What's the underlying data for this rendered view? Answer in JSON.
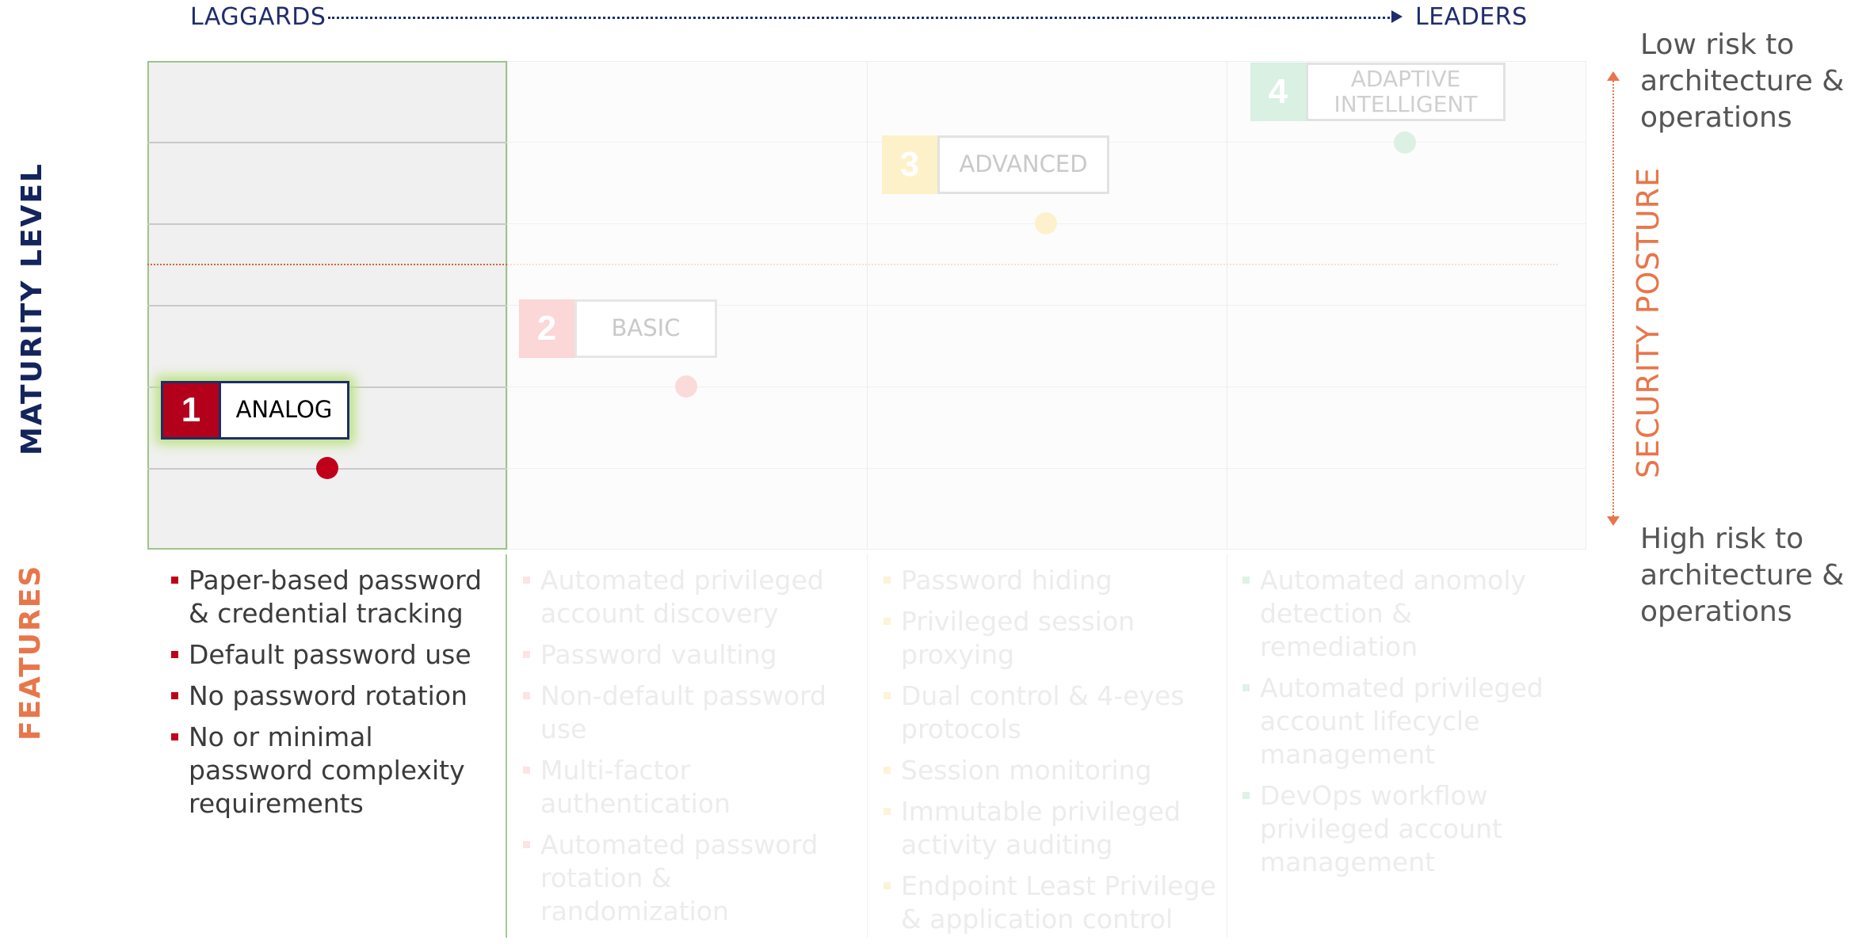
{
  "header": {
    "left_label": "LAGGARDS",
    "right_label": "LEADERS"
  },
  "axis": {
    "maturity_title": "MATURITY  LEVEL",
    "features_title": "FEATURES"
  },
  "security": {
    "title": "SECURITY POSTURE",
    "low_risk": "Low risk to architecture & operations",
    "high_risk": "High risk to architecture & operations",
    "accent": "#e8764a"
  },
  "levels": [
    {
      "number": "1",
      "label": "ANALOG",
      "color": "#b3001b",
      "highlighted": true
    },
    {
      "number": "2",
      "label": "BASIC",
      "color": "#fbd7d7",
      "highlighted": false
    },
    {
      "number": "3",
      "label": "ADVANCED",
      "color": "#fdf1c9",
      "highlighted": false
    },
    {
      "number": "4",
      "label": "ADAPTIVE INTELLIGENT",
      "color": "#d9f0e2",
      "highlighted": false
    }
  ],
  "features": [
    [
      "Paper-based password & credential tracking",
      "Default password use",
      "No password rotation",
      "No or minimal password complexity requirements"
    ],
    [
      "Automated privileged account discovery",
      "Password vaulting",
      "Non-default password use",
      "Multi-factor authentication",
      "Automated password rotation & randomization"
    ],
    [
      "Password hiding",
      "Privileged session proxying",
      "Dual control & 4-eyes protocols",
      "Session monitoring",
      "Immutable privileged activity auditing",
      "Endpoint Least Privilege & application control"
    ],
    [
      "Automated anomoly detection & remediation",
      "Automated privileged account lifecycle management",
      "DevOps workflow privileged account management"
    ]
  ]
}
